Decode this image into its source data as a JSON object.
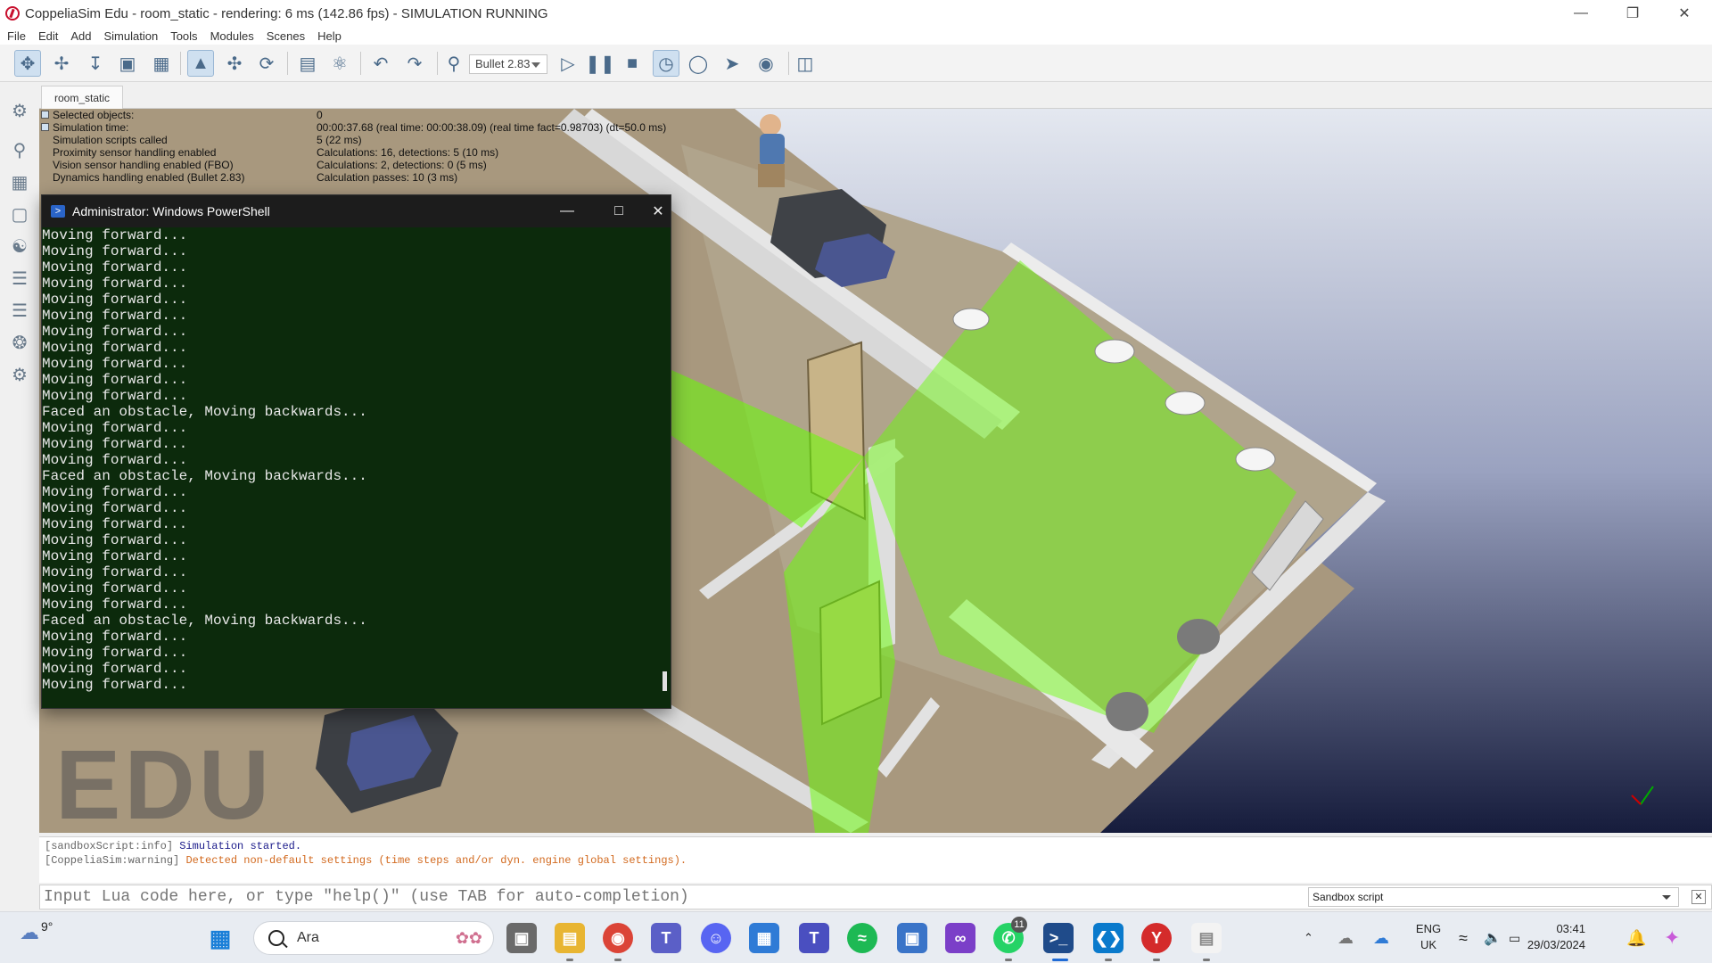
{
  "window": {
    "title": "CoppeliaSim Edu - room_static - rendering: 6 ms (142.86 fps) - SIMULATION RUNNING",
    "minimize_icon": "minimize-icon",
    "restore_icon": "restore-icon",
    "close_icon": "close-icon"
  },
  "menu": [
    "File",
    "Edit",
    "Add",
    "Simulation",
    "Tools",
    "Modules",
    "Scenes",
    "Help"
  ],
  "toolbar": {
    "physics_engine": "Bullet 2.83",
    "icons": [
      "pan-icon",
      "translate-icon",
      "rotate-icon",
      "fit-icon",
      "camera-icon",
      "select-icon",
      "object-shift-icon",
      "object-rotate-icon",
      "assemble-icon",
      "transfer-dna-icon",
      "undo-icon",
      "redo-icon",
      "dynamics-icon",
      "play-icon",
      "pause-icon",
      "stop-icon",
      "real-time-icon",
      "slow-down-icon",
      "speed-up-icon",
      "visualization-icon",
      "toggle-view-icon"
    ]
  },
  "scene_tab": "room_static",
  "info_overlay": [
    {
      "key": "Selected objects:",
      "value": "0"
    },
    {
      "key": "Simulation time:",
      "value": "00:00:37.68 (real time: 00:00:38.09) (real time fact=0.98703) (dt=50.0 ms)"
    },
    {
      "key": "Simulation scripts called",
      "value": "5 (22 ms)"
    },
    {
      "key": "Proximity sensor handling enabled",
      "value": "Calculations: 16, detections: 5 (10 ms)"
    },
    {
      "key": "Vision sensor handling enabled (FBO)",
      "value": "Calculations: 2, detections: 0 (5 ms)"
    },
    {
      "key": "Dynamics handling enabled (Bullet 2.83)",
      "value": "Calculation passes: 10 (3 ms)"
    }
  ],
  "watermark": "EDU",
  "powershell": {
    "title": "Administrator: Windows PowerShell",
    "lines": [
      "Moving forward...",
      "Moving forward...",
      "Moving forward...",
      "Moving forward...",
      "Moving forward...",
      "Moving forward...",
      "Moving forward...",
      "Moving forward...",
      "Moving forward...",
      "Moving forward...",
      "Moving forward...",
      "Faced an obstacle, Moving backwards...",
      "Moving forward...",
      "Moving forward...",
      "Moving forward...",
      "Faced an obstacle, Moving backwards...",
      "Moving forward...",
      "Moving forward...",
      "Moving forward...",
      "Moving forward...",
      "Moving forward...",
      "Moving forward...",
      "Moving forward...",
      "Moving forward...",
      "Faced an obstacle, Moving backwards...",
      "Moving forward...",
      "Moving forward...",
      "Moving forward...",
      "Moving forward..."
    ]
  },
  "console": {
    "line1_tag": "[sandboxScript:info]",
    "line1_msg": "Simulation started.",
    "line2_tag": "[CoppeliaSim:warning]",
    "line2_msg": "Detected non-default settings (time steps and/or dyn. engine global settings)."
  },
  "input": {
    "placeholder": "Input Lua code here, or type \"help()\" (use TAB for auto-completion)",
    "script_selector": "Sandbox script"
  },
  "taskbar": {
    "temperature": "9°",
    "search_text": "Ara",
    "whatsapp_badge": "11",
    "language": "ENG",
    "region": "UK",
    "time": "03:41",
    "date": "29/03/2024"
  },
  "colors": {
    "powershell_bg": "#0c2a0c",
    "sensor_green": "#66ff00",
    "warning": "#d2691e"
  }
}
